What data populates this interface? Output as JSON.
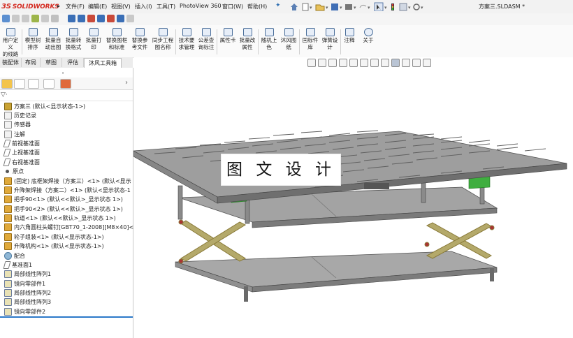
{
  "app": {
    "brand": "SOLIDWORKS",
    "brand_prefix": "3S",
    "document_title": "方案三.SLDASM *"
  },
  "menu": [
    "文件(F)",
    "编辑(E)",
    "视图(V)",
    "插入(I)",
    "工具(T)",
    "PhotoView 360",
    "窗口(W)",
    "帮助(H)"
  ],
  "ribbon": [
    {
      "l1": "用户定义",
      "l2": "的线路"
    },
    {
      "l1": "模型树",
      "l2": "排序"
    },
    {
      "l1": "批量自",
      "l2": "动出图"
    },
    {
      "l1": "批量转",
      "l2": "换格式"
    },
    {
      "l1": "批量打",
      "l2": "印"
    },
    {
      "l1": "替换图框",
      "l2": "和标准"
    },
    {
      "l1": "替换参",
      "l2": "考文件"
    },
    {
      "l1": "同步工程",
      "l2": "图名称"
    },
    {
      "l1": "技术要",
      "l2": "求管理"
    },
    {
      "l1": "公差查",
      "l2": "询标注"
    },
    {
      "l1": "属性卡",
      "l2": ""
    },
    {
      "l1": "批量改",
      "l2": "属性"
    },
    {
      "l1": "随机上",
      "l2": "色"
    },
    {
      "l1": "沐风图",
      "l2": "纸"
    },
    {
      "l1": "国标件",
      "l2": "库"
    },
    {
      "l1": "弹簧设",
      "l2": "计"
    },
    {
      "l1": "注释",
      "l2": ""
    },
    {
      "l1": "关于",
      "l2": ""
    }
  ],
  "tabs": [
    "装配体",
    "布局",
    "草图",
    "评估",
    "沐风工具箱"
  ],
  "filter": {
    "label": "▽·"
  },
  "tree": [
    {
      "label": "方案三  (默认<显示状态-1>)",
      "icon": "assembly-icon"
    },
    {
      "label": "历史记录",
      "icon": "history-icon"
    },
    {
      "label": "传感器",
      "icon": "sensor-icon"
    },
    {
      "label": "注解",
      "icon": "annotation-icon"
    },
    {
      "label": "前视基准面",
      "icon": "plane-icon"
    },
    {
      "label": "上视基准面",
      "icon": "plane-icon"
    },
    {
      "label": "右视基准面",
      "icon": "plane-icon"
    },
    {
      "label": "原点",
      "icon": "origin-icon"
    },
    {
      "label": "(固定) 底框架焊接（方案三）<1> (默认<显示",
      "icon": "part-icon"
    },
    {
      "label": "升降架焊接（方案二）<1> (默认<显示状态-1",
      "icon": "part-icon"
    },
    {
      "label": "把手90<1> (默认<<默认>_显示状态 1>)",
      "icon": "part-icon"
    },
    {
      "label": "把手90<2> (默认<<默认>_显示状态 1>)",
      "icon": "part-icon"
    },
    {
      "label": "轨道<1> (默认<<默认>_显示状态 1>)",
      "icon": "part-icon"
    },
    {
      "label": "内六角圆柱头螺钉[GBT70_1-2008][M8×40]<",
      "icon": "part-icon"
    },
    {
      "label": "轮子组装<1> (默认<显示状态-1>)",
      "icon": "part-icon"
    },
    {
      "label": "升降机构<1> (默认<显示状态-1>)",
      "icon": "part-icon"
    },
    {
      "label": "配合",
      "icon": "mate-icon"
    },
    {
      "label": "基准面1",
      "icon": "plane-icon"
    },
    {
      "label": "局部线性阵列1",
      "icon": "pattern-icon"
    },
    {
      "label": "镜向零部件1",
      "icon": "mirror-icon"
    },
    {
      "label": "局部线性阵列2",
      "icon": "pattern-icon"
    },
    {
      "label": "局部线性阵列3",
      "icon": "pattern-icon"
    },
    {
      "label": "镜向零部件2",
      "icon": "mirror-icon"
    }
  ],
  "overlay_text": "图 文 设 计",
  "colors": {
    "brand_red": "#d42c22",
    "frame_green": "#3fae3f",
    "lift_arm_tan": "#b4a96a",
    "tabletop": "#9e9e9e",
    "selection_blue": "#2b79c9"
  }
}
